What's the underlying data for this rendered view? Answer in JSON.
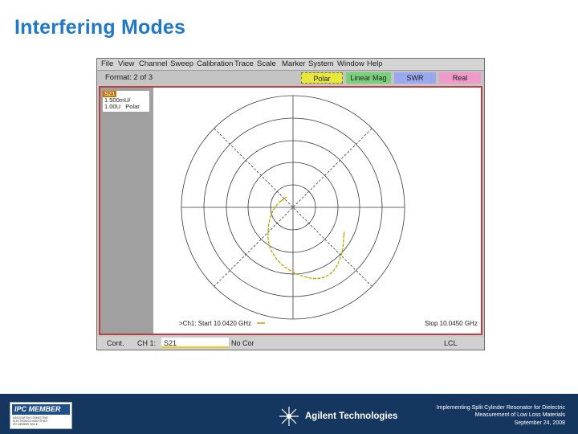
{
  "slide": {
    "title": "Interfering Modes"
  },
  "analyzer": {
    "menu": [
      "File",
      "View",
      "Channel",
      "Sweep",
      "Calibration",
      "Trace",
      "Scale",
      "Marker",
      "System",
      "Window",
      "Help"
    ],
    "format_label": "Format: 2 of 3",
    "softkeys": {
      "polar": "Polar",
      "lin_mag": "Linear Mag",
      "swr": "SWR",
      "real": "Real"
    },
    "trace": {
      "name": "S21",
      "scale": "1.500mU/",
      "ref": "1.00U",
      "format": "Polar"
    },
    "plot": {
      "start_label": ">Ch1: Start 10.0420 GHz",
      "stop_label": "Stop 10.0450 GHz",
      "trace_color": "#c8a000"
    },
    "status": {
      "cont": "Cont.",
      "channel": "CH 1:",
      "trace": "S21",
      "correction": "No Cor",
      "lcl": "LCL"
    }
  },
  "footer": {
    "ipc_badge": "IPC MEMBER",
    "ipc_lines": [
      "ASSOCIATION CONNECTING",
      "ELECTRONICS INDUSTRIES",
      "IPC MEMBER SINCE"
    ],
    "brand": "Agilent Technologies",
    "caption_lines": [
      "Implementing Split Cylinder Resonator for Dielectric",
      "Measurement of Low Loss Materials",
      "September 24, 2008"
    ],
    "background_color": "#15375f"
  }
}
